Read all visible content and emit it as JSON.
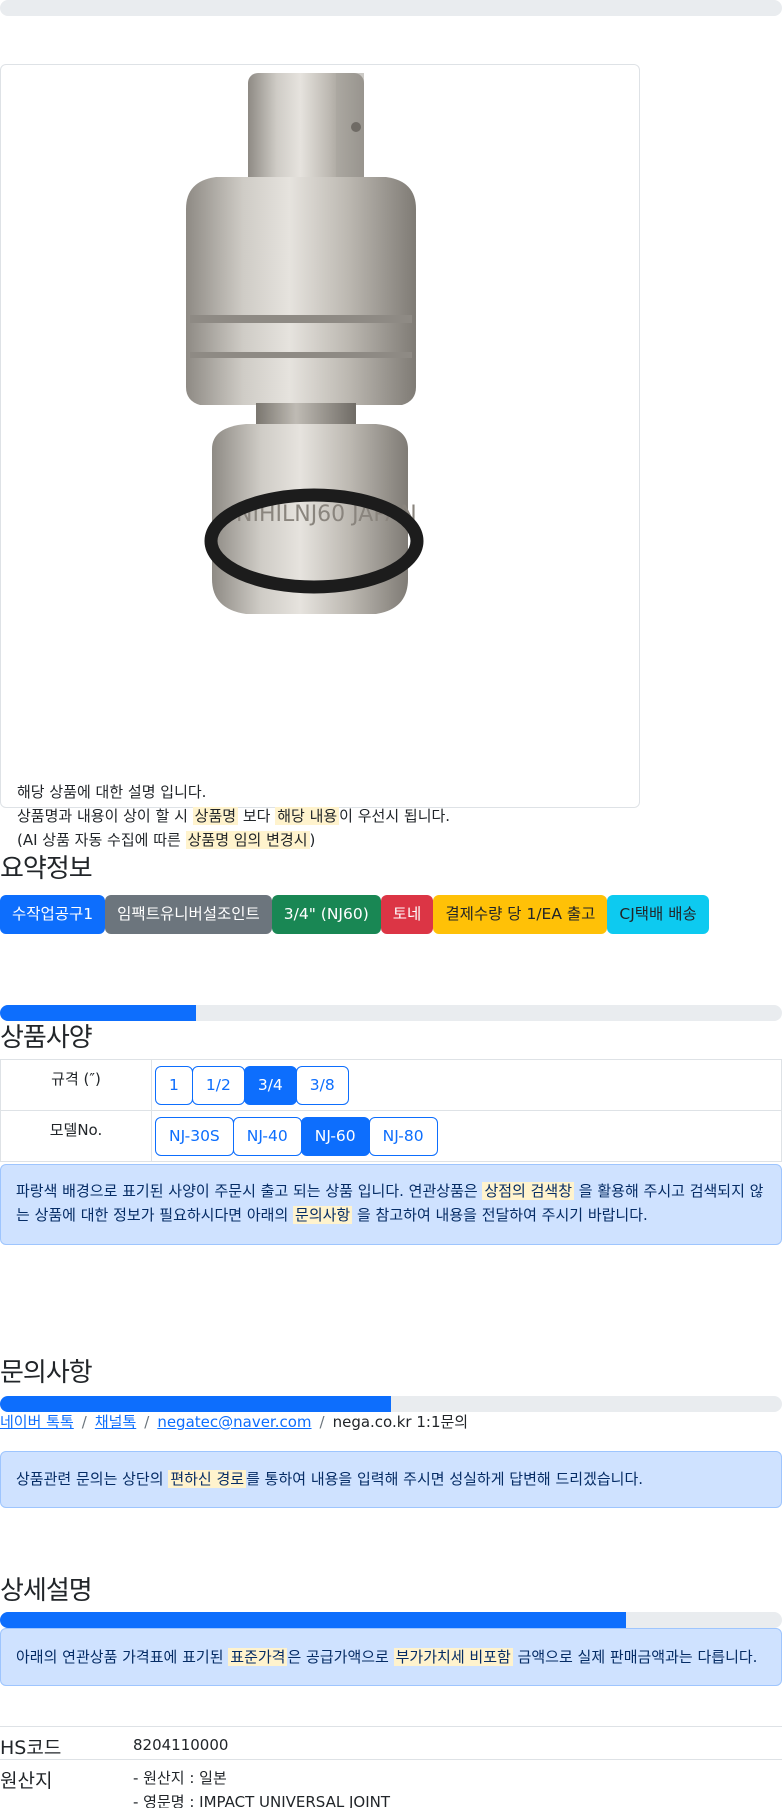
{
  "top_progress": {
    "value": 0
  },
  "product": {
    "image_alt": "Impact universal joint NJ60 product photo",
    "image_engraving": "NIHILNJ60 JAPAN",
    "note": {
      "line1": "해당 상품에 대한 설명 입니다.",
      "line2_a": "상품명과 내용이 상이 할 시 ",
      "line2_hl1": "상품명",
      "line2_b": " 보다 ",
      "line2_hl2": "해당 내용",
      "line2_c": "이 우선시 됩니다.",
      "line3_a": "(AI 상품 자동 수집에 따른 ",
      "line3_hl": "상품명 임의 변경시",
      "line3_b": ")"
    }
  },
  "summary": {
    "title": "요약정보",
    "badges": [
      {
        "label": "수작업공구1",
        "color": "#0d6efd",
        "text_color": "#ffffff"
      },
      {
        "label": "임팩트유니버설조인트",
        "color": "#6c757d",
        "text_color": "#ffffff"
      },
      {
        "label": "3/4\" (NJ60)",
        "color": "#198754",
        "text_color": "#ffffff"
      },
      {
        "label": "토네",
        "color": "#dc3545",
        "text_color": "#ffffff"
      },
      {
        "label": "결제수량 당 1/EA 출고",
        "color": "#ffc107",
        "text_color": "#212529"
      },
      {
        "label": "CJ택배 배송",
        "color": "#0dcaf0",
        "text_color": "#212529"
      }
    ]
  },
  "spec": {
    "progress": 0.25,
    "title": "상품사양",
    "rows": [
      {
        "label": "규격 (″)",
        "options": [
          "1",
          "1/2",
          "3/4",
          "3/8"
        ],
        "selected": 2
      },
      {
        "label": "모델No.",
        "options": [
          "NJ-30S",
          "NJ-40",
          "NJ-60",
          "NJ-80"
        ],
        "selected": 2
      }
    ],
    "alert": {
      "a": "파랑색 배경으로 표기된 사양이 주문시 출고 되는 상품 입니다. 연관상품은 ",
      "hl1": "상점의 검색창",
      "b": " 을 활용해 주시고 검색되지 않는 상품에 대한 정보가 필요하시다면 아래의 ",
      "hl2": "문의사항",
      "c": " 을 참고하여 내용을 전달하여 주시기 바랍니다."
    }
  },
  "inquiry": {
    "title": "문의사항",
    "progress": 0.5,
    "links": [
      "네이버 톡톡",
      "채널톡",
      "negatec@naver.com"
    ],
    "plain": "nega.co.kr 1:1문의",
    "alert": {
      "a": "상품관련 문의는 상단의 ",
      "hl": "편하신 경로",
      "b": "를 통하여 내용을 입력해 주시면 성실하게 답변해 드리겠습니다."
    }
  },
  "detail": {
    "title": "상세설명",
    "progress": 0.8,
    "alert": {
      "a": "아래의 연관상품 가격표에 표기된 ",
      "hl1": "표준가격",
      "b": "은 공급가액으로 ",
      "hl2": "부가가치세 비포함",
      "c": " 금액으로 실제 판매금액과는 다릅니다."
    },
    "hs_label": "HS코드",
    "hs_value": "8204110000",
    "origin_label": "원산지",
    "origin_line1": "- 원산지 : 일본",
    "origin_line2": "- 영문명 : IMPACT UNIVERSAL JOINT"
  }
}
